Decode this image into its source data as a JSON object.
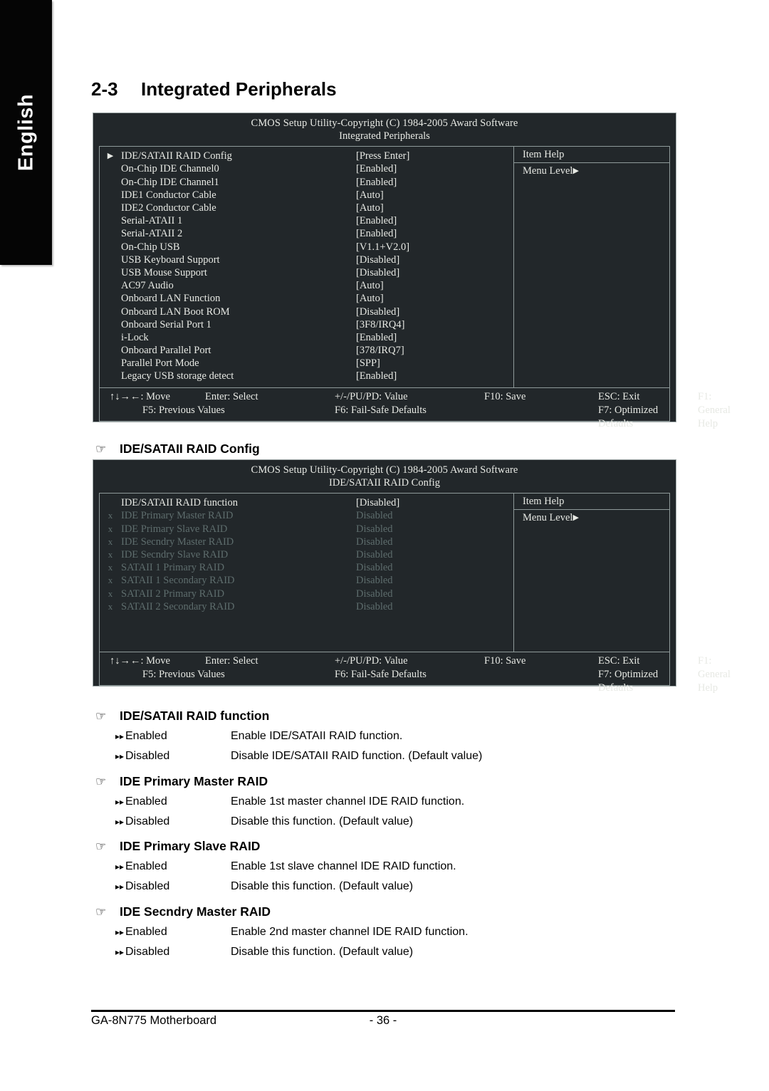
{
  "language_tab": {
    "label": "English"
  },
  "heading": {
    "number": "2-3",
    "title": "Integrated Peripherals"
  },
  "bios_screens": [
    {
      "copyright": "CMOS Setup Utility-Copyright (C) 1984-2005 Award Software",
      "subtitle": "Integrated Peripherals",
      "item_help": {
        "title": "Item Help",
        "menu_level": "Menu Level"
      },
      "rows": [
        {
          "mark": "▶",
          "name": "IDE/SATAII RAID Config",
          "value": "[Press Enter]",
          "dim": false
        },
        {
          "mark": "",
          "name": "On-Chip IDE Channel0",
          "value": "[Enabled]",
          "dim": false
        },
        {
          "mark": "",
          "name": "On-Chip IDE Channel1",
          "value": "[Enabled]",
          "dim": false
        },
        {
          "mark": "",
          "name": "IDE1 Conductor Cable",
          "value": "[Auto]",
          "dim": false
        },
        {
          "mark": "",
          "name": "IDE2 Conductor Cable",
          "value": "[Auto]",
          "dim": false
        },
        {
          "mark": "",
          "name": "Serial-ATAII 1",
          "value": "[Enabled]",
          "dim": false
        },
        {
          "mark": "",
          "name": "Serial-ATAII 2",
          "value": "[Enabled]",
          "dim": false
        },
        {
          "mark": "",
          "name": "On-Chip USB",
          "value": "[V1.1+V2.0]",
          "dim": false
        },
        {
          "mark": "",
          "name": "USB Keyboard Support",
          "value": "[Disabled]",
          "dim": false
        },
        {
          "mark": "",
          "name": "USB Mouse Support",
          "value": "[Disabled]",
          "dim": false
        },
        {
          "mark": "",
          "name": "AC97 Audio",
          "value": "[Auto]",
          "dim": false
        },
        {
          "mark": "",
          "name": "Onboard LAN Function",
          "value": "[Auto]",
          "dim": false
        },
        {
          "mark": "",
          "name": "Onboard LAN Boot ROM",
          "value": "[Disabled]",
          "dim": false
        },
        {
          "mark": "",
          "name": "Onboard Serial Port 1",
          "value": "[3F8/IRQ4]",
          "dim": false
        },
        {
          "mark": "",
          "name": "i-Lock",
          "value": "[Enabled]",
          "dim": false
        },
        {
          "mark": "",
          "name": "Onboard Parallel Port",
          "value": "[378/IRQ7]",
          "dim": false
        },
        {
          "mark": "",
          "name": "Parallel Port Mode",
          "value": "[SPP]",
          "dim": false
        },
        {
          "mark": "",
          "name": "Legacy USB storage detect",
          "value": "[Enabled]",
          "dim": false
        }
      ],
      "footer": {
        "line1": [
          "↑↓→←: Move",
          "Enter: Select",
          "+/-/PU/PD: Value",
          "F10: Save",
          "ESC: Exit",
          "F1: General Help"
        ],
        "line2": [
          "F5: Previous Values",
          "F6: Fail-Safe Defaults",
          "F7: Optimized Defaults"
        ]
      }
    },
    {
      "copyright": "CMOS Setup Utility-Copyright (C) 1984-2005 Award Software",
      "subtitle": "IDE/SATAII RAID Config",
      "item_help": {
        "title": "Item Help",
        "menu_level": "Menu Level"
      },
      "rows": [
        {
          "mark": "",
          "name": "IDE/SATAII RAID function",
          "value": "[Disabled]",
          "dim": false
        },
        {
          "mark": "x",
          "name": "IDE Primary Master RAID",
          "value": "Disabled",
          "dim": true
        },
        {
          "mark": "x",
          "name": "IDE Primary Slave RAID",
          "value": "Disabled",
          "dim": true
        },
        {
          "mark": "x",
          "name": "IDE Secndry Master RAID",
          "value": "Disabled",
          "dim": true
        },
        {
          "mark": "x",
          "name": "IDE Secndry Slave RAID",
          "value": "Disabled",
          "dim": true
        },
        {
          "mark": "x",
          "name": "SATAII 1 Primary RAID",
          "value": "Disabled",
          "dim": true
        },
        {
          "mark": "x",
          "name": "SATAII 1 Secondary RAID",
          "value": "Disabled",
          "dim": true
        },
        {
          "mark": "x",
          "name": "SATAII 2 Primary RAID",
          "value": "Disabled",
          "dim": true
        },
        {
          "mark": "x",
          "name": "SATAII 2 Secondary RAID",
          "value": "Disabled",
          "dim": true
        }
      ],
      "footer": {
        "line1": [
          "↑↓→←: Move",
          "Enter: Select",
          "+/-/PU/PD: Value",
          "F10: Save",
          "ESC: Exit",
          "F1: General Help"
        ],
        "line2": [
          "F5: Previous Values",
          "F6: Fail-Safe Defaults",
          "F7: Optimized Defaults"
        ]
      }
    }
  ],
  "section_raid_config": {
    "title": "IDE/SATAII RAID Config"
  },
  "sections": [
    {
      "title": "IDE/SATAII RAID function",
      "options": [
        {
          "key": "Enabled",
          "desc": "Enable IDE/SATAII RAID function."
        },
        {
          "key": "Disabled",
          "desc": "Disable IDE/SATAII RAID function. (Default value)"
        }
      ]
    },
    {
      "title": "IDE Primary Master RAID",
      "options": [
        {
          "key": "Enabled",
          "desc": "Enable 1st master channel IDE RAID function."
        },
        {
          "key": "Disabled",
          "desc": "Disable this function. (Default value)"
        }
      ]
    },
    {
      "title": "IDE Primary Slave RAID",
      "options": [
        {
          "key": "Enabled",
          "desc": "Enable 1st slave channel IDE RAID function."
        },
        {
          "key": "Disabled",
          "desc": "Disable this function. (Default value)"
        }
      ]
    },
    {
      "title": "IDE Secndry Master RAID",
      "options": [
        {
          "key": "Enabled",
          "desc": "Enable 2nd master channel IDE RAID function."
        },
        {
          "key": "Disabled",
          "desc": "Disable this function. (Default value)"
        }
      ]
    }
  ],
  "page_footer": {
    "product": "GA-8N775 Motherboard",
    "page_number": "- 36 -"
  },
  "glyphs": {
    "hand": "☞",
    "double_arrow": "▸▸",
    "triangle": "▶"
  }
}
